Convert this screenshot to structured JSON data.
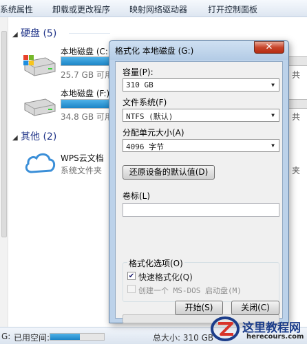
{
  "toolbar": {
    "items": [
      "系统属性",
      "卸载或更改程序",
      "映射网络驱动器",
      "打开控制面板"
    ]
  },
  "groups": [
    {
      "title": "硬盘 (5)"
    },
    {
      "title": "其他 (2)"
    }
  ],
  "drives": [
    {
      "name": "本地磁盘 (C:",
      "free": "25.7 GB 可用",
      "used_fraction": 0.78
    },
    {
      "name": "本地磁盘 (F:)",
      "free": "34.8 GB 可用",
      "used_fraction": 0.85
    }
  ],
  "other_items": [
    {
      "name": "WPS云文档",
      "type": "系统文件夹"
    }
  ],
  "right_fragments": [
    "共",
    "共",
    "夹"
  ],
  "statusbar": {
    "label": "已用空间:",
    "total": "总大小: 310 GB",
    "prefix": "G:",
    "used_fraction": 0.55
  },
  "dialog": {
    "title": "格式化 本地磁盘 (G:)",
    "close_label": "✕",
    "capacity_label": "容量(P):",
    "capacity_value": "310 GB",
    "filesystem_label": "文件系统(F)",
    "filesystem_value": "NTFS (默认)",
    "cluster_label": "分配单元大小(A)",
    "cluster_value": "4096 字节",
    "restore_defaults": "还原设备的默认值(D)",
    "volume_label": "卷标(L)",
    "volume_value": "",
    "options_legend": "格式化选项(O)",
    "quick_format_label": "快速格式化(Q)",
    "quick_format_checked": true,
    "msdos_label": "创建一个 MS-DOS 启动盘(M)",
    "msdos_checked": false,
    "progress": 0,
    "start_button": "开始(S)",
    "close_button": "关闭(C)"
  },
  "watermark": {
    "title": "这里教程网",
    "url": "herecours.com"
  }
}
